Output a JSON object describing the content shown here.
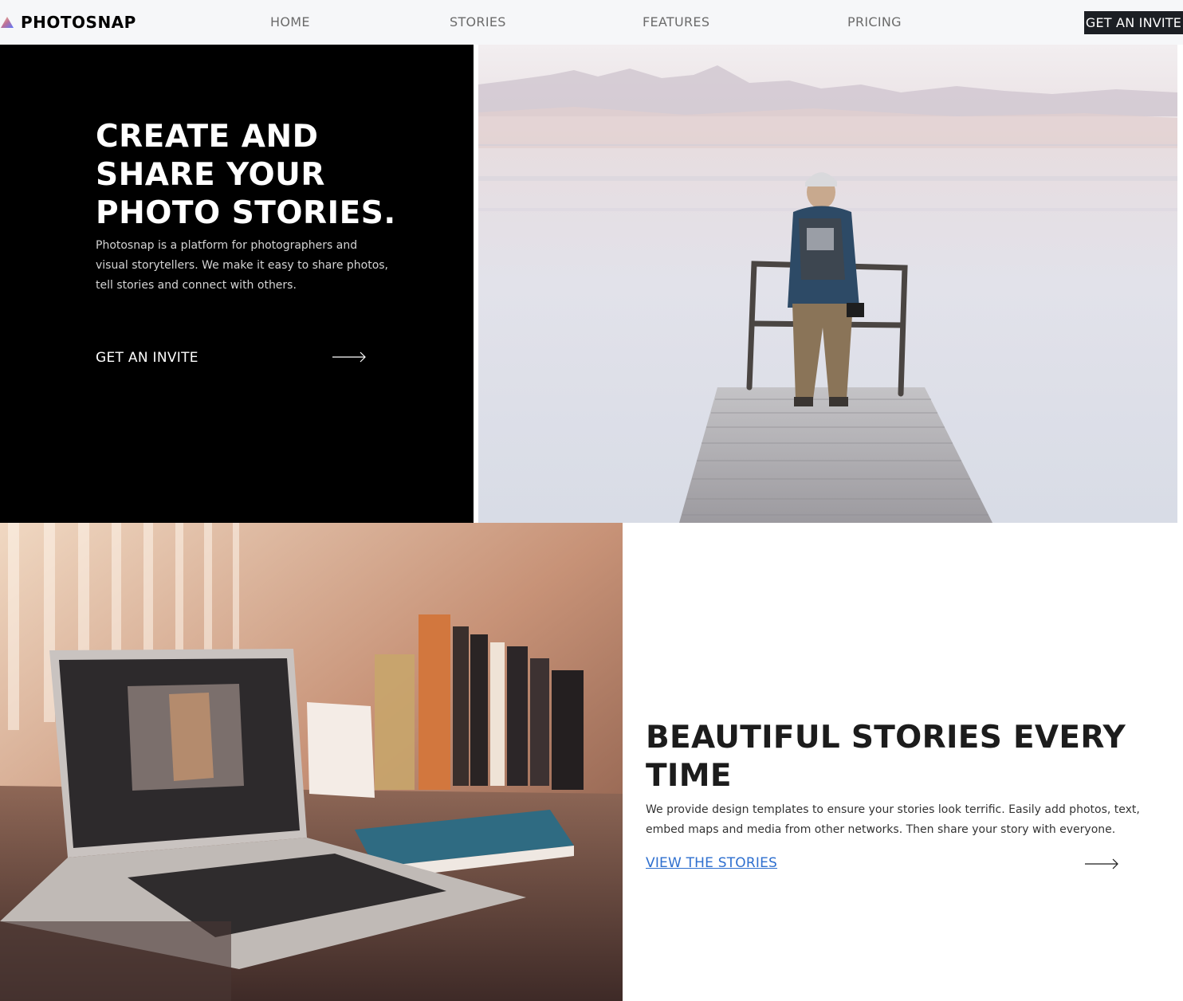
{
  "nav": {
    "logo_text": "PHOTOSNAP",
    "links": [
      "HOME",
      "STORIES",
      "FEATURES",
      "PRICING"
    ],
    "cta_label": "GET AN INVITE"
  },
  "hero": {
    "title_line1": "CREATE AND",
    "title_line2": "SHARE YOUR",
    "title_line3": "PHOTO STORIES.",
    "text": "Photosnap is a platform for photographers and visual storytellers. We make it easy to share photos, tell stories and connect with others.",
    "invite_label": "GET AN INVITE",
    "arrow_icon": "arrow-right-icon"
  },
  "stories": {
    "title": "BEAUTIFUL STORIES EVERY TIME",
    "text": "We provide design templates to ensure your stories look terrific. Easily add photos, text, embed maps and media from other networks. Then share your story with everyone.",
    "link_label": "VIEW THE STORIES",
    "arrow_icon": "arrow-right-icon"
  },
  "colors": {
    "nav_bg": "#f6f7f9",
    "dark": "#000000",
    "cta_bg": "#1c1f24",
    "link_blue": "#2e6fcf"
  }
}
